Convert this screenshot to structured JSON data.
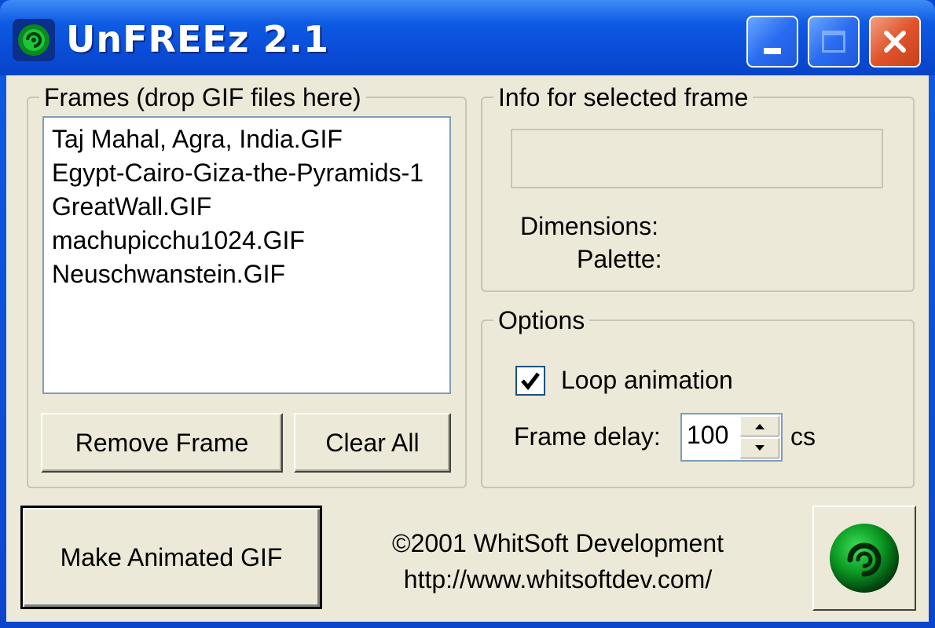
{
  "window": {
    "title": "UnFREEz 2.1",
    "colors": {
      "titlebar": "#0a4bd6",
      "client": "#ece9d8",
      "close": "#e0542c"
    }
  },
  "titlebar_buttons": {
    "minimize_icon": "minimize-icon",
    "maximize_icon": "maximize-icon",
    "close_icon": "close-icon"
  },
  "frames": {
    "legend": "Frames (drop GIF files here)",
    "items": [
      "Taj Mahal, Agra, India.GIF",
      "Egypt-Cairo-Giza-the-Pyramids-1",
      "GreatWall.GIF",
      "machupicchu1024.GIF",
      "Neuschwanstein.GIF"
    ],
    "remove_label": "Remove Frame",
    "clear_label": "Clear All"
  },
  "info": {
    "legend": "Info for selected frame",
    "dimensions_label": "Dimensions:",
    "palette_label": "Palette:"
  },
  "options": {
    "legend": "Options",
    "loop_label": "Loop animation",
    "loop_checked": true,
    "delay_label": "Frame delay:",
    "delay_value": "100",
    "delay_unit": "cs"
  },
  "footer": {
    "make_label": "Make Animated GIF",
    "copyright": "©2001 WhitSoft Development",
    "url": "http://www.whitsoftdev.com/"
  }
}
